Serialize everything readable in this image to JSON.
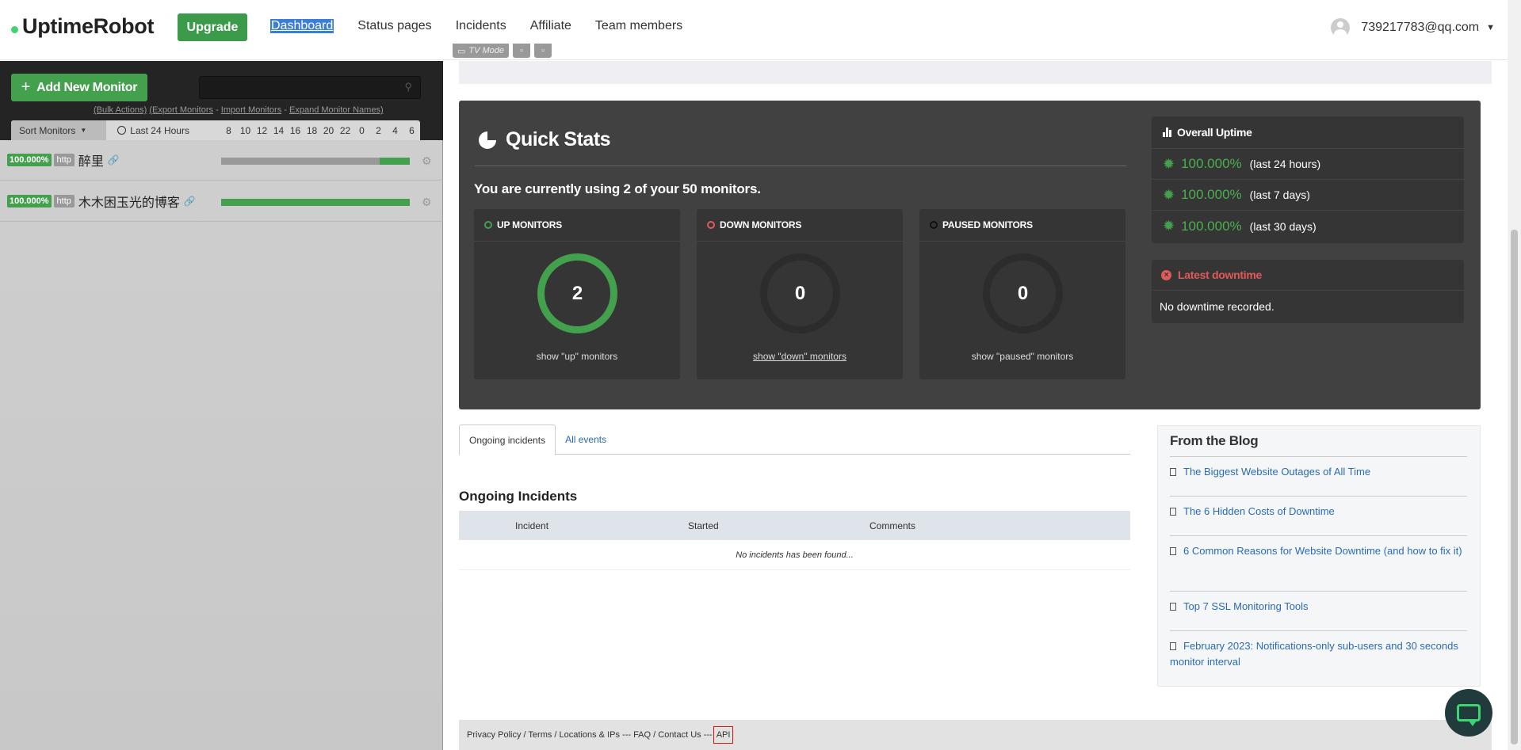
{
  "header": {
    "logo": "UptimeRobot",
    "upgrade": "Upgrade",
    "nav": [
      "Dashboard",
      "Status pages",
      "Incidents",
      "Affiliate",
      "Team members"
    ],
    "user_email": "739217783@qq.com"
  },
  "toolbar": {
    "tv_mode": "TV Mode"
  },
  "sidebar": {
    "add_monitor": "Add New Monitor",
    "bulk_actions": "(Bulk Actions)",
    "export": "(Export Monitors",
    "import": "Import Monitors",
    "expand": "Expand Monitor Names)",
    "sort": "Sort Monitors",
    "last24": "Last 24 Hours",
    "hours": [
      "8",
      "10",
      "12",
      "14",
      "16",
      "18",
      "20",
      "22",
      "0",
      "2",
      "4",
      "6"
    ],
    "monitors": [
      {
        "uptime": "100.000%",
        "type": "http",
        "name": "醉里"
      },
      {
        "uptime": "100.000%",
        "type": "http",
        "name": "木木困玉光的博客"
      }
    ]
  },
  "quick_stats": {
    "title": "Quick Stats",
    "using": "You are currently using 2 of your 50 monitors.",
    "up": {
      "label": "UP MONITORS",
      "count": "2",
      "link": "show \"up\" monitors"
    },
    "down": {
      "label": "DOWN MONITORS",
      "count": "0",
      "link": "show \"down\" monitors"
    },
    "paused": {
      "label": "PAUSED MONITORS",
      "count": "0",
      "link": "show \"paused\" monitors"
    }
  },
  "overall_uptime": {
    "title": "Overall Uptime",
    "rows": [
      {
        "pct": "100.000%",
        "period": "(last 24 hours)"
      },
      {
        "pct": "100.000%",
        "period": "(last 7 days)"
      },
      {
        "pct": "100.000%",
        "period": "(last 30 days)"
      }
    ]
  },
  "latest_downtime": {
    "title": "Latest downtime",
    "body": "No downtime recorded."
  },
  "incidents": {
    "tab_ongoing": "Ongoing incidents",
    "tab_all": "All events",
    "title": "Ongoing Incidents",
    "col_incident": "Incident",
    "col_started": "Started",
    "col_comments": "Comments",
    "empty": "No incidents has been found..."
  },
  "blog": {
    "title": "From the Blog",
    "items": [
      "The Biggest Website Outages of All Time",
      "The 6 Hidden Costs of Downtime",
      "6 Common Reasons for Website Downtime (and how to fix it)",
      "Top 7 SSL Monitoring Tools",
      "February 2023: Notifications-only sub-users and 30 seconds monitor interval"
    ]
  },
  "footer": {
    "links": "Privacy Policy / Terms / Locations & IPs --- FAQ / Contact Us ---",
    "api": "API"
  },
  "colors": {
    "green": "#43a04c",
    "dark_panel": "#414141",
    "link_blue": "#2a6ab8",
    "down_red": "#e05a5a"
  }
}
